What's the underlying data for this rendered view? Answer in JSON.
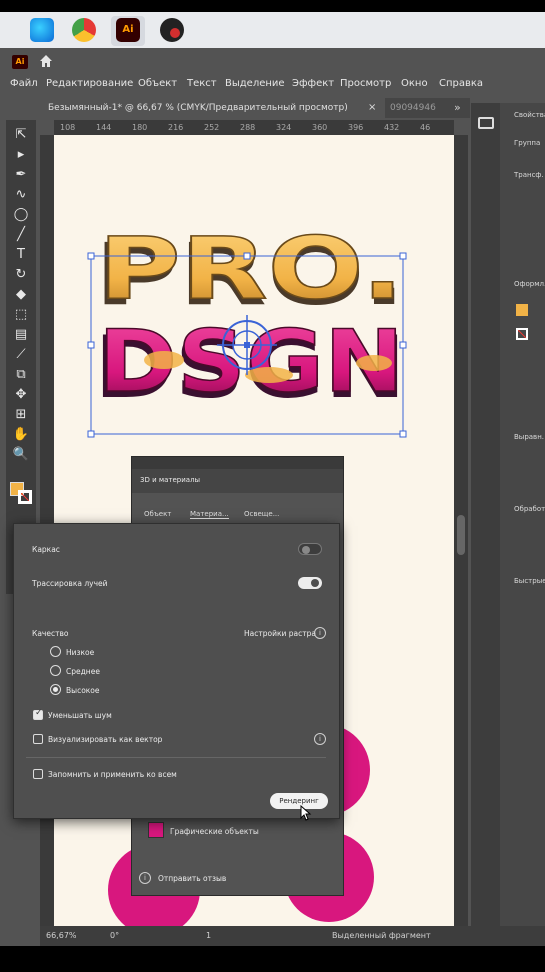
{
  "taskbar": {
    "apps": [
      "edge-app",
      "chrome-app",
      "illustrator-app",
      "other-app"
    ],
    "illustrator_label": "Ai"
  },
  "app": {
    "badge": "Ai",
    "menu": [
      "Файл",
      "Редактирование",
      "Объект",
      "Текст",
      "Выделение",
      "Эффект",
      "Просмотр",
      "Окно",
      "Справка"
    ],
    "document_tab": "Безымянный-1* @ 66,67 % (CMYK/Предварительный просмотр)",
    "document_tab_close": "×",
    "second_tab": "09094946",
    "tabs_more": "»",
    "ruler_ticks": [
      "108",
      "144",
      "180",
      "216",
      "252",
      "288",
      "324",
      "360",
      "396",
      "432",
      "46"
    ]
  },
  "artwork": {
    "line1": "PRO.",
    "line2": "DSGN",
    "colors": {
      "top": "#f2b347",
      "bottom": "#d8177e",
      "accent": "#e9a6c8"
    }
  },
  "right_panel": {
    "title": "Свойства",
    "items": [
      "Группа",
      "Трансф.",
      "Оформл.",
      "Выравн.",
      "Обработка",
      "Быстрые"
    ]
  },
  "panel3d": {
    "title": "3D и материалы",
    "tabs": [
      "Объект",
      "Материа...",
      "Освеще..."
    ],
    "layer_row": "Графические объекты",
    "feedback": "Отправить отзыв"
  },
  "render": {
    "wireframe_label": "Каркас",
    "wireframe_on": false,
    "raytrace_label": "Трассировка лучей",
    "raytrace_on": true,
    "quality_label": "Качество",
    "raster_settings": "Настройки растра",
    "quality_options": [
      "Низкое",
      "Среднее",
      "Высокое"
    ],
    "quality_selected": 2,
    "reduce_noise_label": "Уменьшать шум",
    "reduce_noise_checked": true,
    "vector_label": "Визуализировать как вектор",
    "vector_checked": false,
    "remember_label": "Запомнить и применить ко всем",
    "remember_checked": false,
    "render_button": "Рендеринг"
  },
  "status": {
    "zoom": "66,67%",
    "rotation": "0°",
    "artboard": "1",
    "selection": "Выделенный фрагмент"
  },
  "colors": {
    "accent_blue": "#3a63d6",
    "fill_swatch": "#f2b347",
    "magenta": "#d8177e"
  }
}
